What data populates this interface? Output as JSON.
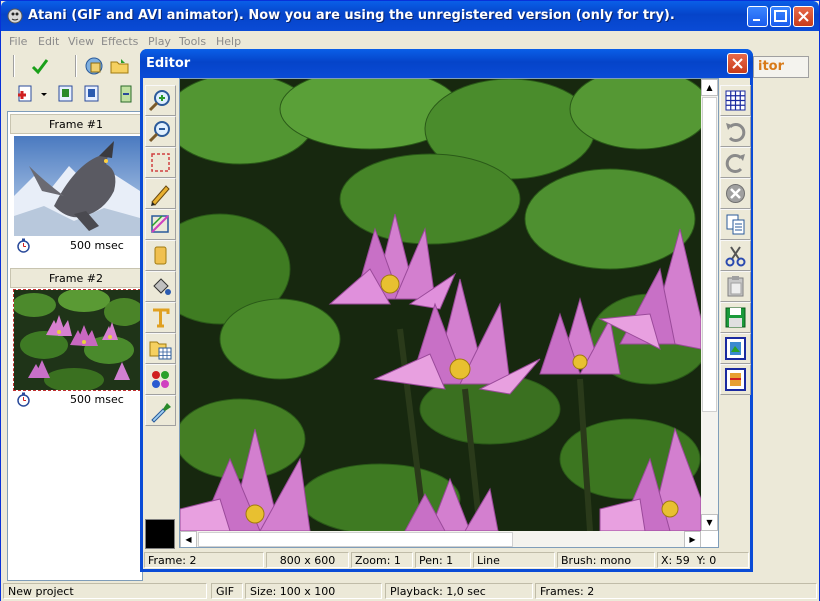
{
  "app": {
    "title": "Atani (GIF and AVI animator). Now you are using the unregistered version (only for try)."
  },
  "menu": {
    "items": [
      "File",
      "Edit",
      "View",
      "Effects",
      "Play",
      "Tools",
      "Help"
    ]
  },
  "toolbar": {
    "editor_tab_label": "itor"
  },
  "frames": [
    {
      "label": "Frame #1",
      "delay": "500 msec",
      "thumb": "dragon-scene"
    },
    {
      "label": "Frame #2",
      "delay": "500 msec",
      "thumb": "water-lilies"
    }
  ],
  "status": {
    "project": "New project",
    "format": "GIF",
    "size": "Size: 100 x 100",
    "playback": "Playback: 1,0 sec",
    "frames": "Frames: 2"
  },
  "editor": {
    "title": "Editor",
    "status": {
      "frame": "Frame: 2",
      "dimensions": "800 x 600",
      "zoom": "Zoom: 1",
      "pen": "Pen: 1",
      "tool": "Line",
      "brush": "Brush: mono",
      "coords": "X: 59  Y: 0"
    },
    "current_color": "#000000"
  },
  "colors": {
    "title_bar": "#0a4bd6",
    "window_bg": "#ece9d8",
    "close_button": "#c73b1a",
    "editor_tab_text": "#d87a18"
  }
}
